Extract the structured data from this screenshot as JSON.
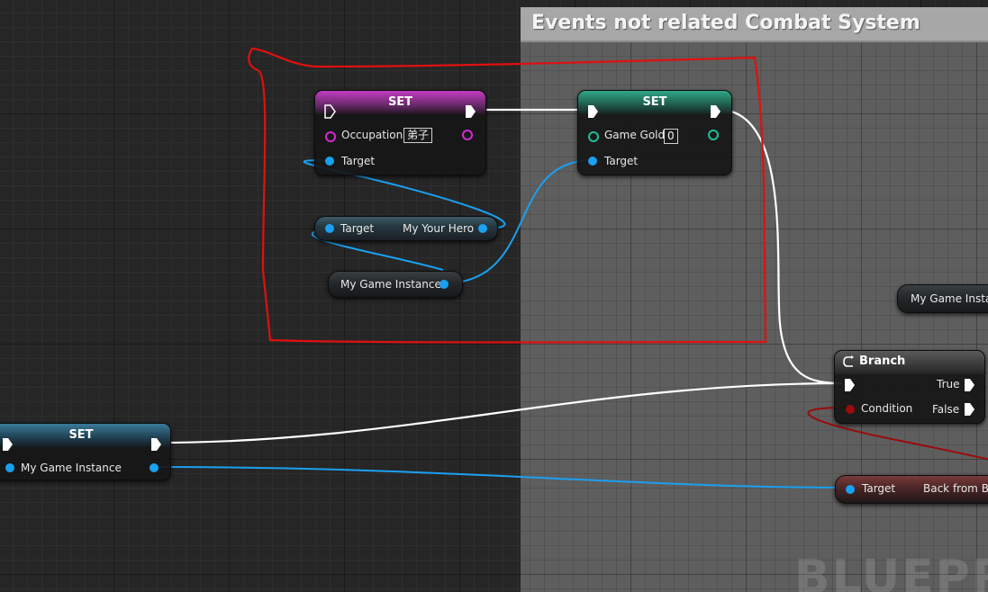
{
  "comment": {
    "title": "Events not related Combat System",
    "watermark": "BLUEPR"
  },
  "nodes": {
    "set_occupation": {
      "title": "SET",
      "var_label": "Occupation",
      "var_value": "弟子",
      "target_label": "Target",
      "header_color": "#9a2b9a"
    },
    "set_gold": {
      "title": "SET",
      "var_label": "Game Gold",
      "var_value": "0",
      "target_label": "Target",
      "header_color": "#1f8a6a"
    },
    "get_my_your_hero": {
      "target_label": "Target",
      "output_label": "My Your Hero"
    },
    "get_game_instance_1": {
      "label": "My Game Instance"
    },
    "get_game_instance_2": {
      "label": "My Game Instan"
    },
    "set_game_instance": {
      "title": "SET",
      "var_label": "My Game Instance",
      "header_color": "#2a6a8a"
    },
    "branch": {
      "title": "Branch",
      "condition_label": "Condition",
      "true_label": "True",
      "false_label": "False"
    },
    "get_back_from": {
      "target_label": "Target",
      "output_label": "Back from Ba"
    }
  },
  "colors": {
    "exec_wire": "#ffffff",
    "object_wire": "#1aa0f0",
    "bool_wire": "#9a0b0b",
    "annotation": "#e01010"
  },
  "icons": [
    "branch-icon",
    "exec-pin-icon",
    "object-pin-icon"
  ]
}
